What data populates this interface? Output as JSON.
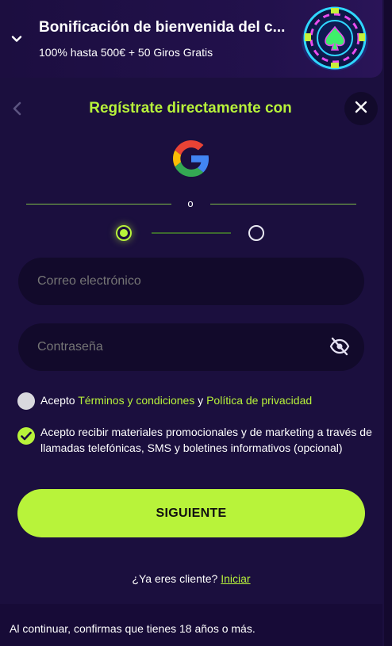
{
  "banner": {
    "title": "Bonificación de bienvenida del c...",
    "subtitle": "100% hasta 500€ + 50 Giros Gratis",
    "expand_icon": "chevron-down-icon",
    "art_icon": "casino-chip-spade-icon"
  },
  "header": {
    "heading": "Regístrate directamente con",
    "back_icon": "chevron-left-icon",
    "close_icon": "close-icon"
  },
  "social": {
    "google_icon": "google-icon",
    "divider_text": "o"
  },
  "steps": {
    "current": 1,
    "total": 2
  },
  "form": {
    "email_placeholder": "Correo electrónico",
    "password_placeholder": "Contraseña",
    "password_toggle_icon": "eye-off-icon"
  },
  "consents": {
    "terms_prefix": "Acepto ",
    "terms_link": "Términos y condiciones",
    "terms_and": " y ",
    "privacy_link": "Política de privacidad",
    "terms_checked": false,
    "promo_text": "Acepto recibir materiales promocionales y de marketing a través de llamadas telefónicas, SMS y boletines informativos (opcional)",
    "promo_checked": true
  },
  "actions": {
    "next_label": "SIGUIENTE",
    "existing_client_text": "¿Ya eres cliente?",
    "login_link": "Iniciar"
  },
  "footer": {
    "age_notice": "Al continuar, confirmas que tienes 18 años o más."
  },
  "colors": {
    "background": "#1b0f3e",
    "accent": "#b8f33a",
    "field": "#120a2b"
  }
}
